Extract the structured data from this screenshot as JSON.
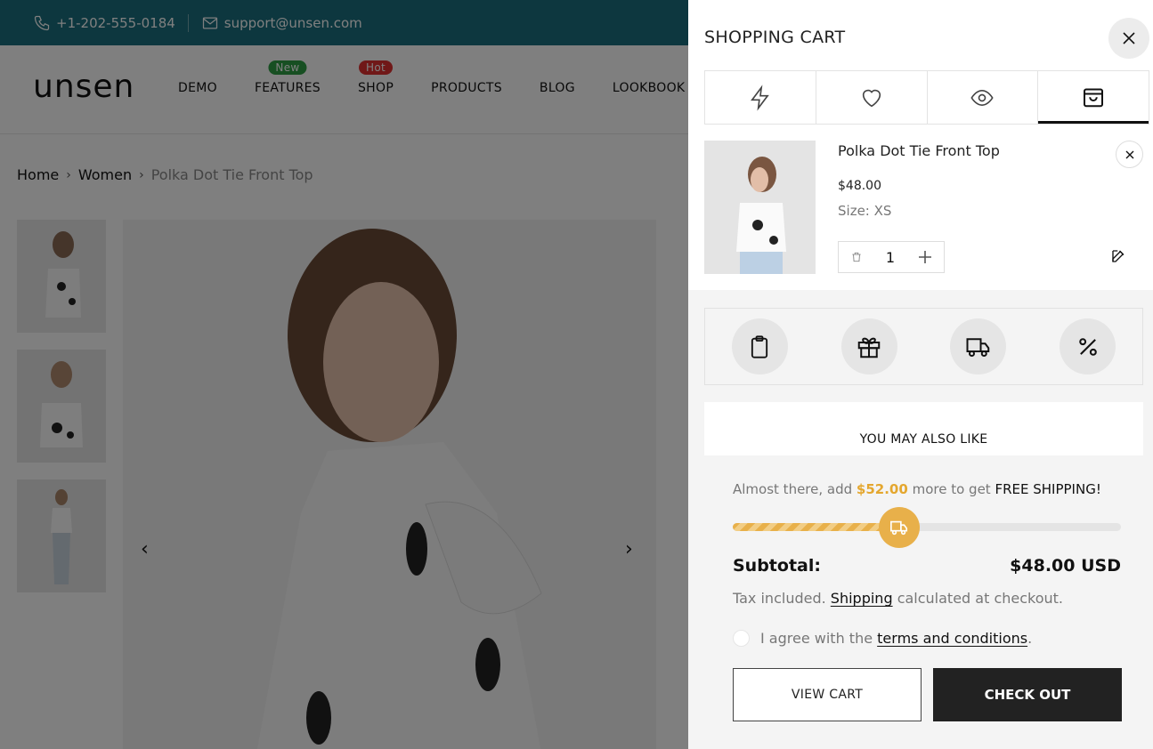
{
  "topbar": {
    "phone": "+1-202-555-0184",
    "email": "support@unsen.com"
  },
  "header": {
    "logo": "unsen",
    "nav": [
      {
        "label": "DEMO",
        "badge": ""
      },
      {
        "label": "FEATURES",
        "badge": "New"
      },
      {
        "label": "SHOP",
        "badge": "Hot"
      },
      {
        "label": "PRODUCTS",
        "badge": ""
      },
      {
        "label": "BLOG",
        "badge": ""
      },
      {
        "label": "LOOKBOOK",
        "badge": ""
      }
    ]
  },
  "breadcrumb": {
    "home": "Home",
    "category": "Women",
    "current": "Polka Dot Tie Front Top"
  },
  "drawer": {
    "title": "SHOPPING CART",
    "tabs": [
      "flash-icon",
      "heart-icon",
      "eye-icon",
      "bag-icon"
    ],
    "item": {
      "name": "Polka Dot Tie Front Top",
      "price": "$48.00",
      "size_label": "Size:",
      "size_value": "XS",
      "quantity": "1"
    },
    "tools": [
      "note-icon",
      "gift-icon",
      "truck-icon",
      "percent-icon"
    ],
    "also_like": "YOU MAY ALSO LIKE",
    "shipping": {
      "prefix": "Almost there, add",
      "amount": "$52.00",
      "middle": "more to get",
      "free": "FREE SHIPPING!",
      "progress_fraction": 0.43
    },
    "subtotal_label": "Subtotal:",
    "subtotal_value": "$48.00 USD",
    "tax": {
      "prefix": "Tax included.",
      "link": "Shipping",
      "suffix": "calculated at checkout."
    },
    "agree": {
      "prefix": "I agree with the",
      "link": "terms and conditions",
      "suffix": "."
    },
    "view_cart": "VIEW CART",
    "checkout": "CHECK OUT"
  },
  "colors": {
    "topbar": "#1a6f7e",
    "accent": "#e8b04a",
    "dark": "#222222"
  }
}
